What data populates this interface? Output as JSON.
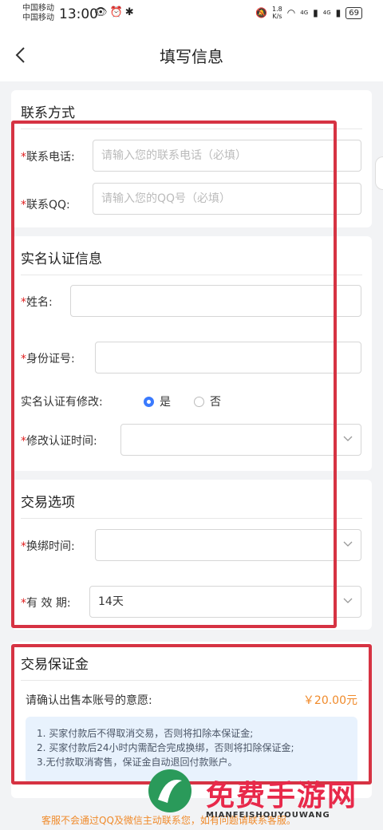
{
  "status": {
    "carrier1": "中国移动",
    "carrier2": "中国移动",
    "time": "13:00",
    "speed_value": "1.8",
    "speed_unit": "K/s",
    "net1": "4G",
    "net2": "4G",
    "battery": "69"
  },
  "header": {
    "title": "填写信息"
  },
  "contact": {
    "title": "联系方式",
    "phone_label": "联系电话:",
    "phone_placeholder": "请输入您的联系电话（必填）",
    "qq_label": "联系QQ:",
    "qq_placeholder": "请输入您的QQ号（必填）"
  },
  "realname": {
    "title": "实名认证信息",
    "name_label": "姓名:",
    "id_label": "身份证号:",
    "modified_label": "实名认证有修改:",
    "option_yes": "是",
    "option_no": "否",
    "selected": "是",
    "modify_time_label": "修改认证时间:"
  },
  "trade": {
    "title": "交易选项",
    "rebind_label": "换绑时间:",
    "validity_label": "有 效 期:",
    "validity_value": "14天"
  },
  "deposit": {
    "title": "交易保证金",
    "confirm_text": "请确认出售本账号的意愿:",
    "amount": "￥20.00元",
    "notes": [
      "1. 买家付款后不得取消交易，否则将扣除本保证金;",
      "2. 买家付款后24小时内需配合完成换绑，否则将扣除保证金;",
      "3.无付款取消寄售，保证金自动退回付款账户。"
    ]
  },
  "footer": {
    "text": "客服不会通过QQ及微信主动联系您，如有问题请联系客服。"
  },
  "watermark": {
    "text": "免费手游网",
    "sub": "MIANFEISHOUYOUWANG"
  },
  "colors": {
    "required": "#e02020",
    "accent": "#3a7afe",
    "price": "#f08a2a",
    "highlight": "#d63343"
  }
}
